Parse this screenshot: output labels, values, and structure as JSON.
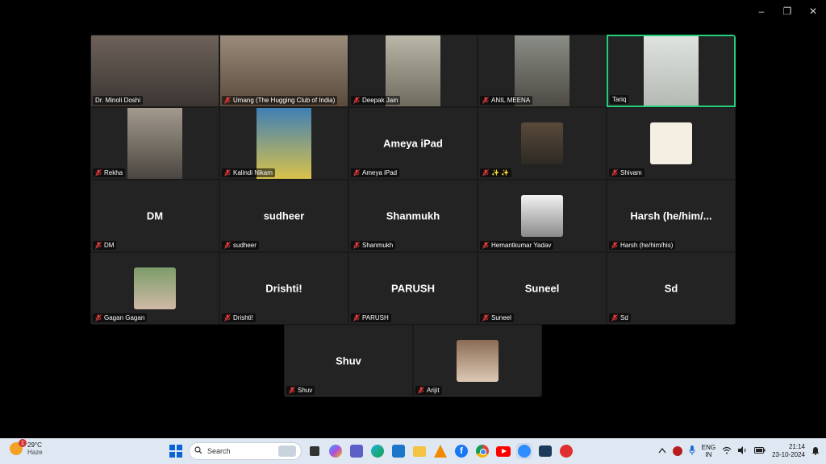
{
  "window": {
    "minimize": "–",
    "restore": "❐",
    "close": "✕"
  },
  "tiles": [
    {
      "name": "Dr. Minoli  Doshi",
      "kind": "video",
      "muted": false
    },
    {
      "name": "Umang (The Hugging Club of India)",
      "kind": "video",
      "muted": true
    },
    {
      "name": "Deepak Jain",
      "kind": "video",
      "muted": true
    },
    {
      "name": "ANIL MEENA",
      "kind": "video",
      "muted": true
    },
    {
      "name": "Tariq",
      "kind": "video",
      "muted": false
    },
    {
      "name": "Rekha",
      "kind": "video",
      "muted": true
    },
    {
      "name": "Kalindi Nikam",
      "kind": "video",
      "muted": true
    },
    {
      "name": "Ameya iPad",
      "kind": "text",
      "big": "Ameya iPad",
      "muted": true
    },
    {
      "name": "✨ ✨",
      "kind": "thumb",
      "muted": true
    },
    {
      "name": "Shivam",
      "kind": "thumb",
      "muted": true
    },
    {
      "name": "DM",
      "kind": "text",
      "big": "DM",
      "muted": true
    },
    {
      "name": "sudheer",
      "kind": "text",
      "big": "sudheer",
      "muted": true
    },
    {
      "name": "Shanmukh",
      "kind": "text",
      "big": "Shanmukh",
      "muted": true
    },
    {
      "name": "Hemantkumar Yadav",
      "kind": "thumb",
      "muted": true
    },
    {
      "name": "Harsh (he/him/his)",
      "kind": "text",
      "big": "Harsh  (he/him/...",
      "muted": true
    },
    {
      "name": "Gagan Gagan",
      "kind": "thumb",
      "muted": true
    },
    {
      "name": "Drishti!",
      "kind": "text",
      "big": "Drishti!",
      "muted": true
    },
    {
      "name": "PARUSH",
      "kind": "text",
      "big": "PARUSH",
      "muted": true
    },
    {
      "name": "Suneel",
      "kind": "text",
      "big": "Suneel",
      "muted": true
    },
    {
      "name": "Sd",
      "kind": "text",
      "big": "Sd",
      "muted": true
    }
  ],
  "bottom_tiles": [
    {
      "name": "Shuv",
      "kind": "text",
      "big": "Shuv",
      "muted": true
    },
    {
      "name": "Arijit",
      "kind": "thumb",
      "muted": true
    }
  ],
  "taskbar": {
    "weather_temp": "29°C",
    "weather_desc": "Haze",
    "weather_badge": "1",
    "search_placeholder": "Search",
    "lang_top": "ENG",
    "lang_bottom": "IN",
    "time": "21:14",
    "date": "23-10-2024",
    "icons": [
      "start-icon",
      "search-icon",
      "task-view-icon",
      "copilot-icon",
      "teams-icon",
      "edge-icon",
      "store-icon",
      "file-explorer-icon",
      "vlc-icon",
      "facebook-icon",
      "chrome-icon",
      "youtube-icon",
      "zoom-icon",
      "media-player-icon",
      "wps-icon"
    ]
  }
}
